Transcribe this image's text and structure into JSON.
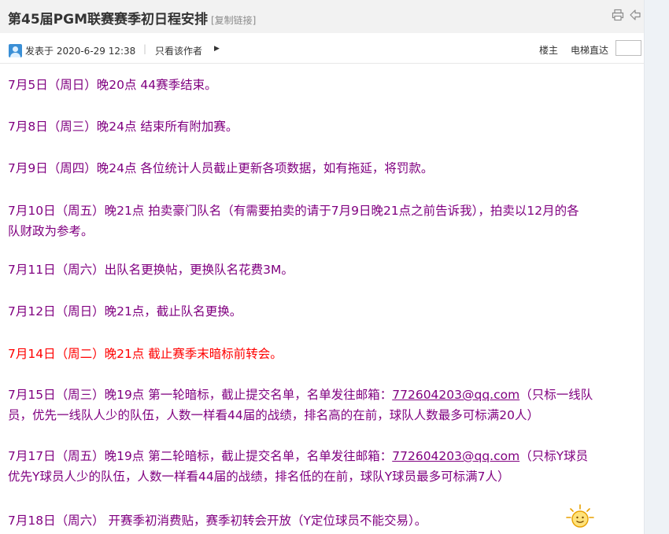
{
  "header": {
    "title": "第45届PGM联赛赛季初日程安排",
    "copy_link": "[复制链接]"
  },
  "post_meta": {
    "posted_label": "发表于 2020-6-29 12:38",
    "separator": "|",
    "author_only": "只看该作者",
    "floor_owner": "楼主",
    "elevator": "电梯直达"
  },
  "content": {
    "p1": "7月5日（周日）晚20点 44赛季结束。",
    "p2": "7月8日（周三）晚24点 结束所有附加赛。",
    "p3": "7月9日（周四）晚24点 各位统计人员截止更新各项数据，如有拖延，将罚款。",
    "p4_line1": "7月10日（周五）晚21点 拍卖豪门队名（有需要拍卖的请于7月9日晚21点之前告诉我），拍卖以12月的各",
    "p4_line2": "队财政为参考。",
    "p5": "7月11日（周六）出队名更换帖，更换队名花费3M。",
    "p6": "7月12日（周日）晚21点，截止队名更换。",
    "p7": "7月14日（周二）晚21点 截止赛季末暗标前转会。",
    "p8_pre": "7月15日（周三）晚19点 第一轮暗标，截止提交名单，名单发往邮箱：",
    "p8_email": "772604203@qq.com",
    "p8_post": "（只标一线队",
    "p8_line2": "员，优先一线队人少的队伍，人数一样看44届的战绩，排名高的在前，球队人数最多可标满20人）",
    "p9_pre": "7月17日（周五）晚19点 第二轮暗标，截止提交名单，名单发往邮箱：",
    "p9_email": "772604203@qq.com",
    "p9_post": "（只标Y球员",
    "p9_line2": "优先Y球员人少的队伍，人数一样看44届的战绩，排名低的在前，球队Y球员最多可标满7人）",
    "p10": "7月18日（周六） 开赛季初消费贴，赛季初转会开放（Y定位球员不能交易）。"
  },
  "colors": {
    "text_purple": "#800080",
    "text_red": "#ff0000",
    "header_bg": "#f2f2f2"
  },
  "icons": [
    "print-icon",
    "back-arrow-icon",
    "user-icon",
    "caret-right-icon",
    "sun-badge-icon"
  ]
}
